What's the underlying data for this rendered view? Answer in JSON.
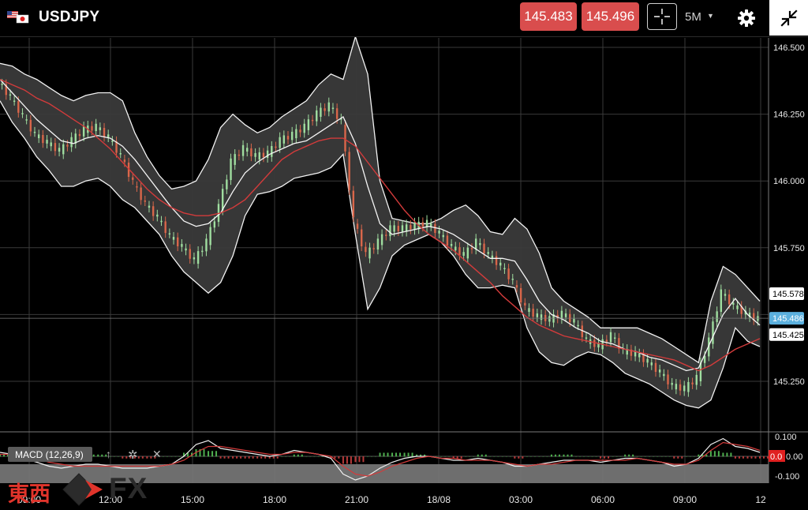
{
  "header": {
    "symbol": "USDJPY",
    "bid": "145.483",
    "ask": "145.496",
    "interval": "5M",
    "icons": [
      "us-japan-flag-icon",
      "crosshair-icon",
      "dropdown-caret-icon",
      "gear-icon",
      "collapse-icon"
    ]
  },
  "indicator": {
    "label": "MACD (12,26,9)",
    "icons": [
      "arrow-up-icon",
      "gear-icon",
      "close-icon"
    ]
  },
  "chart_data": {
    "type": "candlestick",
    "ylim": [
      145.05,
      146.56
    ],
    "y_ticks": [
      "146.500",
      "146.250",
      "146.000",
      "145.750",
      "145.250"
    ],
    "x_ticks": [
      "09:00",
      "12:00",
      "15:00",
      "18:00",
      "21:00",
      "18/08",
      "03:00",
      "06:00",
      "09:00",
      "12"
    ],
    "price_labels": [
      {
        "text": "145.578",
        "value": 145.578,
        "color": "#ffffff"
      },
      {
        "text": "145.486",
        "value": 145.486,
        "color": "#5bb0de"
      },
      {
        "text": "145.425",
        "value": 145.425,
        "color": "#ffffff"
      }
    ],
    "bb_mid": [
      146.38,
      146.33,
      146.28,
      146.23,
      146.19,
      146.15,
      146.14,
      146.16,
      146.17,
      146.16,
      146.13,
      146.08,
      146.02,
      145.96,
      145.9,
      145.85,
      145.83,
      145.84,
      145.88,
      145.96,
      146.03,
      146.07,
      146.1,
      146.12,
      146.14,
      146.15,
      146.18,
      146.21,
      146.24,
      146.14,
      145.98,
      145.84,
      145.8,
      145.81,
      145.82,
      145.83,
      145.82,
      145.8,
      145.77,
      145.74,
      145.71,
      145.71,
      145.7,
      145.63,
      145.55,
      145.5,
      145.48,
      145.45,
      145.43,
      145.4,
      145.39,
      145.37,
      145.36,
      145.34,
      145.33,
      145.31,
      145.29,
      145.3,
      145.4,
      145.5,
      145.56,
      145.5,
      145.46
    ],
    "bb_up": [
      146.44,
      146.43,
      146.4,
      146.38,
      146.35,
      146.32,
      146.3,
      146.32,
      146.33,
      146.33,
      146.3,
      146.18,
      146.09,
      146.02,
      145.97,
      145.98,
      146.0,
      146.08,
      146.2,
      146.25,
      146.21,
      146.18,
      146.2,
      146.24,
      146.27,
      146.3,
      146.36,
      146.4,
      146.38,
      146.54,
      146.4,
      146.0,
      145.86,
      145.85,
      145.84,
      145.84,
      145.86,
      145.89,
      145.91,
      145.87,
      145.81,
      145.8,
      145.86,
      145.82,
      145.73,
      145.6,
      145.55,
      145.52,
      145.49,
      145.45,
      145.45,
      145.45,
      145.45,
      145.43,
      145.41,
      145.38,
      145.35,
      145.32,
      145.55,
      145.68,
      145.65,
      145.6,
      145.55
    ],
    "bb_lo": [
      146.3,
      146.22,
      146.16,
      146.09,
      146.04,
      145.98,
      145.98,
      146.0,
      146.01,
      145.98,
      145.93,
      145.9,
      145.85,
      145.8,
      145.72,
      145.66,
      145.62,
      145.58,
      145.62,
      145.72,
      145.87,
      145.95,
      145.96,
      145.98,
      146.01,
      146.02,
      146.03,
      146.05,
      146.1,
      145.8,
      145.52,
      145.6,
      145.72,
      145.76,
      145.78,
      145.8,
      145.77,
      145.72,
      145.65,
      145.6,
      145.6,
      145.61,
      145.6,
      145.45,
      145.36,
      145.32,
      145.31,
      145.34,
      145.36,
      145.35,
      145.32,
      145.28,
      145.26,
      145.24,
      145.21,
      145.18,
      145.16,
      145.15,
      145.18,
      145.3,
      145.45,
      145.4,
      145.38
    ],
    "sma_red": [
      146.38,
      146.36,
      146.34,
      146.31,
      146.29,
      146.26,
      146.23,
      146.2,
      146.16,
      146.12,
      146.07,
      146.02,
      145.97,
      145.93,
      145.9,
      145.88,
      145.87,
      145.87,
      145.88,
      145.9,
      145.93,
      145.98,
      146.03,
      146.08,
      146.11,
      146.13,
      146.15,
      146.16,
      146.16,
      146.13,
      146.07,
      146.01,
      145.95,
      145.89,
      145.84,
      145.8,
      145.77,
      145.74,
      145.7,
      145.66,
      145.62,
      145.57,
      145.53,
      145.49,
      145.46,
      145.44,
      145.42,
      145.41,
      145.4,
      145.39,
      145.38,
      145.37,
      145.36,
      145.35,
      145.34,
      145.33,
      145.31,
      145.29,
      145.31,
      145.34,
      145.37,
      145.39,
      145.41
    ],
    "close": [
      146.37,
      146.31,
      146.24,
      146.17,
      146.14,
      146.11,
      146.15,
      146.19,
      146.2,
      146.16,
      146.09,
      145.99,
      145.91,
      145.86,
      145.79,
      145.75,
      145.7,
      145.77,
      145.9,
      146.07,
      146.12,
      146.09,
      146.1,
      146.15,
      146.17,
      146.2,
      146.25,
      146.28,
      146.22,
      145.85,
      145.72,
      145.77,
      145.82,
      145.82,
      145.83,
      145.84,
      145.8,
      145.75,
      145.72,
      145.77,
      145.72,
      145.68,
      145.62,
      145.52,
      145.49,
      145.48,
      145.5,
      145.47,
      145.4,
      145.38,
      145.42,
      145.36,
      145.35,
      145.32,
      145.28,
      145.23,
      145.22,
      145.26,
      145.4,
      145.58,
      145.53,
      145.5,
      145.48
    ],
    "macd": [
      0.02,
      0.01,
      -0.01,
      -0.03,
      -0.05,
      -0.06,
      -0.05,
      -0.04,
      -0.04,
      -0.05,
      -0.06,
      -0.06,
      -0.06,
      -0.05,
      -0.04,
      0.0,
      0.06,
      0.08,
      0.04,
      0.03,
      0.02,
      0.01,
      0.0,
      0.01,
      0.03,
      0.02,
      0.01,
      -0.01,
      -0.09,
      -0.12,
      -0.1,
      -0.06,
      -0.03,
      -0.01,
      0.0,
      0.0,
      -0.01,
      -0.02,
      -0.02,
      -0.01,
      -0.02,
      -0.03,
      -0.05,
      -0.05,
      -0.04,
      -0.03,
      -0.02,
      -0.02,
      -0.02,
      -0.03,
      -0.02,
      -0.01,
      -0.01,
      -0.02,
      -0.03,
      -0.05,
      -0.04,
      -0.01,
      0.06,
      0.09,
      0.05,
      0.04,
      0.02
    ],
    "macd_signal": [
      0.01,
      0.01,
      0.0,
      -0.01,
      -0.03,
      -0.04,
      -0.05,
      -0.05,
      -0.05,
      -0.05,
      -0.05,
      -0.05,
      -0.05,
      -0.05,
      -0.04,
      -0.02,
      0.02,
      0.05,
      0.05,
      0.04,
      0.03,
      0.02,
      0.01,
      0.01,
      0.02,
      0.02,
      0.01,
      0.0,
      -0.05,
      -0.09,
      -0.1,
      -0.08,
      -0.05,
      -0.03,
      -0.01,
      0.0,
      -0.01,
      -0.01,
      -0.02,
      -0.02,
      -0.02,
      -0.03,
      -0.04,
      -0.05,
      -0.04,
      -0.04,
      -0.03,
      -0.02,
      -0.02,
      -0.02,
      -0.02,
      -0.02,
      -0.01,
      -0.02,
      -0.03,
      -0.04,
      -0.04,
      -0.02,
      0.03,
      0.07,
      0.06,
      0.05,
      0.03
    ],
    "macd_ticks": [
      "0.100",
      "0.00",
      "-0.100"
    ],
    "macd_value_label": "0.0",
    "grid": true
  },
  "watermark": {
    "text_jp": "東西",
    "text_fx": "FX"
  }
}
